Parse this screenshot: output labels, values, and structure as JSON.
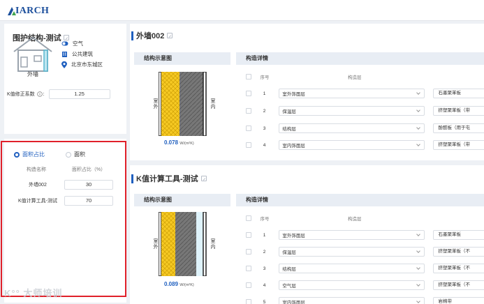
{
  "app": {
    "logo_text": "IARCH"
  },
  "envelope": {
    "title": "围护结构-测试",
    "house_label": "外墙",
    "props": [
      {
        "icon": "toggle-icon",
        "text": "空气"
      },
      {
        "icon": "building-icon",
        "text": "公共建筑"
      },
      {
        "icon": "location-pin-icon",
        "text": "北京市东城区"
      }
    ],
    "k_label": "K值修正系数",
    "k_value": "1.25"
  },
  "ratio": {
    "options": [
      "面积占比",
      "面积"
    ],
    "selected": "面积占比",
    "headers": [
      "构造名称",
      "面积占比（%）"
    ],
    "rows": [
      {
        "name": "外墙002",
        "value": "30"
      },
      {
        "name": "K值计算工具-测试",
        "value": "70"
      }
    ]
  },
  "watermark": "K°° 大师培训",
  "sections": [
    {
      "title": "外墙002",
      "diagram_label": "结构示意图",
      "detail_label": "构造详情",
      "outside": "室外",
      "inside": "室内",
      "u_value": "0.078",
      "u_unit": "W/(m²K)",
      "header_num": "序号",
      "header_layer": "构造层",
      "rows": [
        {
          "n": "1",
          "layer": "室外饰面层",
          "mat": "石墨聚苯板"
        },
        {
          "n": "2",
          "layer": "保温层",
          "mat": "挤塑聚苯板（带"
        },
        {
          "n": "3",
          "layer": "结构层",
          "mat": "酚醛板（用于屯"
        },
        {
          "n": "4",
          "layer": "室内饰面层",
          "mat": "挤塑聚苯板（带"
        }
      ]
    },
    {
      "title": "K值计算工具-测试",
      "diagram_label": "结构示意图",
      "detail_label": "构造详情",
      "outside": "室外",
      "inside": "室内",
      "u_value": "0.089",
      "u_unit": "W/(m²K)",
      "header_num": "序号",
      "header_layer": "构造层",
      "rows": [
        {
          "n": "1",
          "layer": "室外饰面层",
          "mat": "石墨聚苯板"
        },
        {
          "n": "2",
          "layer": "保温层",
          "mat": "挤塑聚苯板（不"
        },
        {
          "n": "3",
          "layer": "结构层",
          "mat": "挤塑聚苯板（不"
        },
        {
          "n": "4",
          "layer": "空气层",
          "mat": "挤塑聚苯板（不"
        },
        {
          "n": "5",
          "layer": "室内饰面层",
          "mat": "岩棉带"
        }
      ]
    }
  ]
}
